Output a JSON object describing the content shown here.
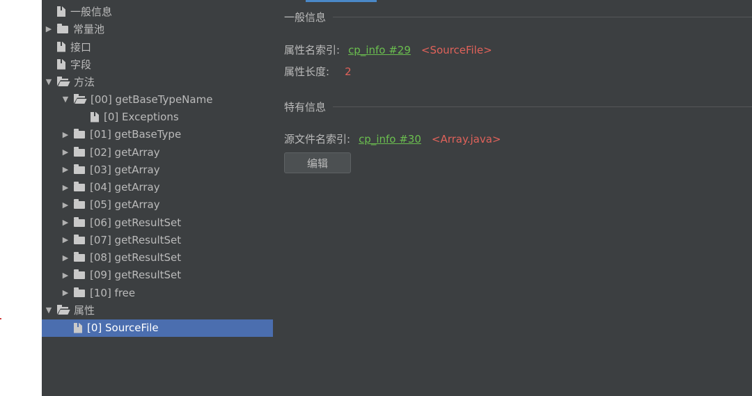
{
  "tree": {
    "items": [
      {
        "label": "一般信息",
        "type": "file",
        "expander": "none",
        "level": 0
      },
      {
        "label": "常量池",
        "type": "folder",
        "expander": "collapsed",
        "level": 0
      },
      {
        "label": "接口",
        "type": "file",
        "expander": "none",
        "level": 0
      },
      {
        "label": "字段",
        "type": "file",
        "expander": "none",
        "level": 0
      },
      {
        "label": "方法",
        "type": "folder-open",
        "expander": "expanded",
        "level": 0
      },
      {
        "label": "[00] getBaseTypeName",
        "type": "folder-open",
        "expander": "expanded",
        "level": 1
      },
      {
        "label": "[0] Exceptions",
        "type": "file",
        "expander": "none",
        "level": 2
      },
      {
        "label": "[01] getBaseType",
        "type": "folder",
        "expander": "collapsed",
        "level": 1
      },
      {
        "label": "[02] getArray",
        "type": "folder",
        "expander": "collapsed",
        "level": 1
      },
      {
        "label": "[03] getArray",
        "type": "folder",
        "expander": "collapsed",
        "level": 1
      },
      {
        "label": "[04] getArray",
        "type": "folder",
        "expander": "collapsed",
        "level": 1
      },
      {
        "label": "[05] getArray",
        "type": "folder",
        "expander": "collapsed",
        "level": 1
      },
      {
        "label": "[06] getResultSet",
        "type": "folder",
        "expander": "collapsed",
        "level": 1
      },
      {
        "label": "[07] getResultSet",
        "type": "folder",
        "expander": "collapsed",
        "level": 1
      },
      {
        "label": "[08] getResultSet",
        "type": "folder",
        "expander": "collapsed",
        "level": 1
      },
      {
        "label": "[09] getResultSet",
        "type": "folder",
        "expander": "collapsed",
        "level": 1
      },
      {
        "label": "[10] free",
        "type": "folder",
        "expander": "collapsed",
        "level": 1
      },
      {
        "label": "属性",
        "type": "folder-open",
        "expander": "expanded",
        "level": 0
      },
      {
        "label": "[0] SourceFile",
        "type": "file",
        "expander": "none",
        "level": 1,
        "selected": true
      }
    ]
  },
  "detail": {
    "general_section": "一般信息",
    "attr_name_index_label": "属性名索引:",
    "attr_name_index_link": "cp_info #29",
    "attr_name_index_value": "<SourceFile>",
    "attr_length_label": "属性长度:",
    "attr_length_value": "2",
    "specific_section": "特有信息",
    "source_file_index_label": "源文件名索引:",
    "source_file_index_link": "cp_info #30",
    "source_file_index_value": "<Array.java>",
    "edit_button": "编辑"
  },
  "colors": {
    "panel_bg": "#3c3f41",
    "selection": "#4b6eaf",
    "link": "#6bbf4f",
    "value_red": "#e0625a",
    "accent_tab": "#4a88c7"
  }
}
